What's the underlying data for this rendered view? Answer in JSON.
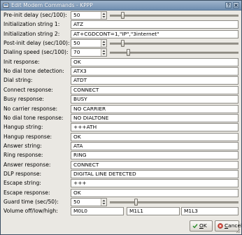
{
  "window": {
    "title": "Edit Modem Commands - KPPP"
  },
  "rows": [
    {
      "label": "Pre-init delay (sec/100):",
      "type": "slider",
      "value": "50",
      "level_percent": 10
    },
    {
      "label": "Initialization string 1:",
      "type": "text",
      "value": "ATZ"
    },
    {
      "label": "Initialization string 2:",
      "type": "text",
      "value": "AT+CGDCONT=1,\"IP\",\"3internet\""
    },
    {
      "label": "Post-init delay (sec/100):",
      "type": "slider",
      "value": "50",
      "level_percent": 10
    },
    {
      "label": "Dialing speed (sec/100):",
      "type": "slider",
      "value": "70",
      "level_percent": 14
    },
    {
      "label": "Init response:",
      "type": "text",
      "value": "OK"
    },
    {
      "label": "No dial tone detection:",
      "type": "text",
      "value": "ATX3"
    },
    {
      "label": "Dial string:",
      "type": "text",
      "value": "ATDT"
    },
    {
      "label": "Connect response:",
      "type": "text",
      "value": "CONNECT"
    },
    {
      "label": "Busy response:",
      "type": "text",
      "value": "BUSY"
    },
    {
      "label": "No carrier response:",
      "type": "text",
      "value": "NO CARRIER"
    },
    {
      "label": "No dial tone response:",
      "type": "text",
      "value": "NO DIALTONE"
    },
    {
      "label": "Hangup string:",
      "type": "text",
      "value": "+++ATH"
    },
    {
      "label": "Hangup response:",
      "type": "text",
      "value": "OK"
    },
    {
      "label": "Answer string:",
      "type": "text",
      "value": "ATA"
    },
    {
      "label": "Ring response:",
      "type": "text",
      "value": "RING"
    },
    {
      "label": "Answer response:",
      "type": "text",
      "value": "CONNECT"
    },
    {
      "label": "DLP response:",
      "type": "text",
      "value": "DIGITAL LINE DETECTED"
    },
    {
      "label": "Escape string:",
      "type": "text",
      "value": "+++"
    },
    {
      "label": "Escape response:",
      "type": "text",
      "value": "OK"
    },
    {
      "label": "Guard time (sec/50):",
      "type": "slider",
      "value": "50",
      "level_percent": 20
    },
    {
      "label": "Volume off/low/high:",
      "type": "triple",
      "values": [
        "M0L0",
        "M1L1",
        "M1L3"
      ]
    }
  ],
  "buttons": {
    "ok": {
      "mnemonic": "O",
      "rest": "K"
    },
    "cancel": {
      "mnemonic": "C",
      "rest": "ancel"
    }
  },
  "icons": {
    "app": "kppp-icon",
    "help": "help-icon",
    "close": "close-icon",
    "ok": "checkmark-icon",
    "cancel": "cancel-icon",
    "grip": "resize-grip-icon"
  },
  "colors": {
    "titlebar": "#7f9bba",
    "dialog_bg": "#eae8e3",
    "ok_icon": "#2f8f2f",
    "cancel_icon": "#c0281e"
  }
}
